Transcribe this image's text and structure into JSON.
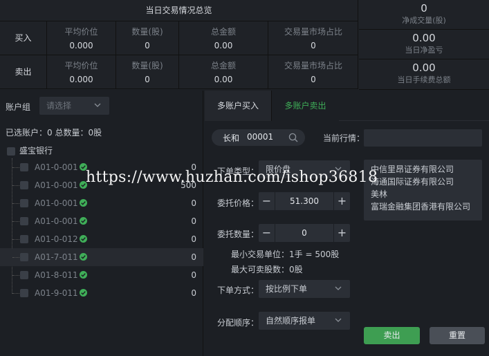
{
  "summary": {
    "title": "当日交易情况总览",
    "columns": [
      "平均价位",
      "数量(股)",
      "总金额",
      "交易量市场占比"
    ],
    "buy": {
      "label": "买入",
      "avg_price": "0.000",
      "quantity": "0",
      "amount": "0.00",
      "share": "0"
    },
    "sell": {
      "label": "卖出",
      "avg_price": "0.000",
      "quantity": "0",
      "amount": "0.00",
      "share": "0"
    },
    "net_volume": {
      "value": "0",
      "label": "净成交量(股)"
    },
    "net_pnl": {
      "value": "0.00",
      "label": "当日净盈亏"
    },
    "fees": {
      "value": "0.00",
      "label": "当日手续费总额"
    }
  },
  "left": {
    "group_label": "账户组",
    "group_placeholder": "请选择",
    "selected_info": "已选账户：0 总数量：0股",
    "root": "盛宝银行",
    "accounts": [
      {
        "name": "A01-0-001",
        "qty": "0"
      },
      {
        "name": "A01-0-001",
        "qty": "500"
      },
      {
        "name": "A01-0-001",
        "qty": "0"
      },
      {
        "name": "A01-0-001",
        "qty": "0"
      },
      {
        "name": "A01-0-012",
        "qty": "0"
      },
      {
        "name": "A01-7-011",
        "qty": "0"
      },
      {
        "name": "A01-8-011",
        "qty": "0"
      },
      {
        "name": "A01-9-011",
        "qty": "0"
      }
    ]
  },
  "right": {
    "tabs": [
      "多账户买入",
      "多账户卖出"
    ],
    "stock_name": "长和",
    "stock_code": "00001",
    "quote_label": "当前行情：",
    "order_type_label": "下单类型：",
    "order_type": "限价盘",
    "price_label": "委托价格：",
    "price": "51.300",
    "qty_label": "委托数量：",
    "qty": "0",
    "min_unit": "最小交易单位：1手 = 500股",
    "max_sell": "最大可卖股数：0股",
    "method_label": "下单方式：",
    "method": "按比例下单",
    "order_seq_label": "分配顺序：",
    "order_seq": "自然顺序报单",
    "brokers": [
      "中信里昂证券有限公司",
      "海通国际证券有限公司",
      "美林",
      "富瑞金融集团香港有限公司"
    ],
    "sell_button": "卖出",
    "reset_button": "重置"
  },
  "watermark": "https://www.huzhan.com/ishop36818"
}
